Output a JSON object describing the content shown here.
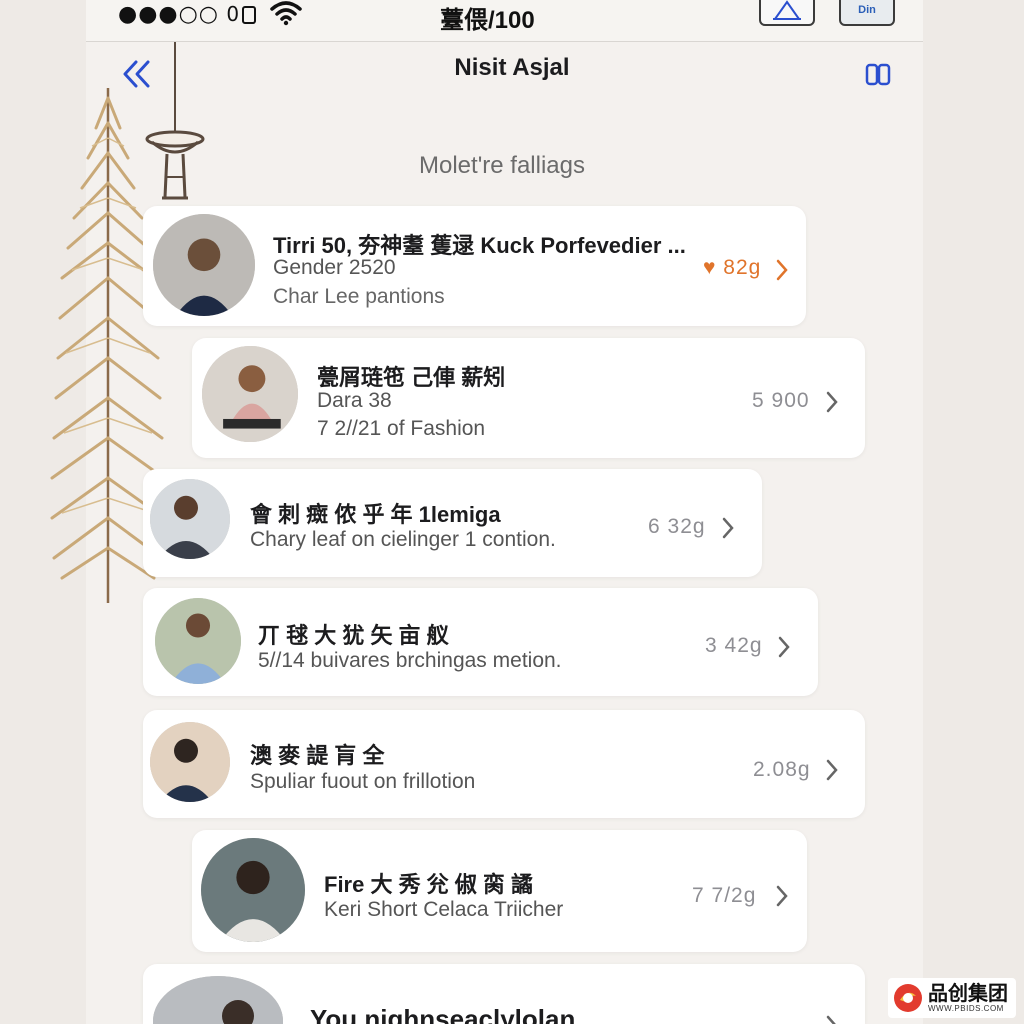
{
  "status_bar": {
    "signal": "●●●○○",
    "time": "薹偎/100",
    "right_button_text": "Din"
  },
  "nav": {
    "title": "Nisit Asjal",
    "back_icon": "double-chevron-left-icon",
    "right_icon": "book-icon"
  },
  "section_title": "Molet're falliags",
  "cards": [
    {
      "title": "Tirri 50, 夯神耋 蒦逯 Kuck Porfevedier ...",
      "line1": "Gender 2520",
      "line2": "Char Lee pantions",
      "meta": "♥ 82g",
      "accent": true
    },
    {
      "title": "甍屑琏竾 己俥 薪矧",
      "line1": "Dara 38",
      "line2": "7 2//21 of Fashion",
      "meta": "5 900",
      "accent": false
    },
    {
      "title": "會 刺 癍 侬 乎 年 1lemiga",
      "line1": "Chary leaf on cielinger 1 contion.",
      "meta": "6 32g",
      "accent": false
    },
    {
      "title": "丌 毬 大 犹 矢  亩 舣",
      "line1": "5//14 buivares brchingas metion.",
      "meta": "3 42g",
      "accent": false
    },
    {
      "title": "澳 麥 諟  肓 全",
      "line1": "Spuliar fuout on frillotion",
      "meta": "2.08g",
      "accent": false
    },
    {
      "title": "Fire 大 秀  兊 俶  脔 譎",
      "line1": "Keri Short Celaca Triicher",
      "meta": "7 7/2g",
      "accent": false
    },
    {
      "title": "You nighnseaclylolan",
      "accent": false
    }
  ],
  "watermark": {
    "main": "品创集团",
    "sub": "WWW.PBIDS.COM"
  },
  "colors": {
    "accent": "#e0742b",
    "link": "#2b4fcf",
    "background": "#eeeae6"
  }
}
